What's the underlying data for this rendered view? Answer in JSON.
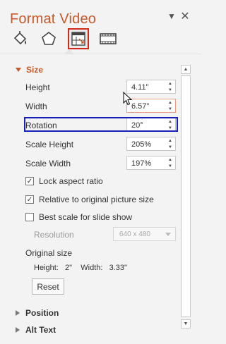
{
  "header": {
    "title": "Format Video",
    "dropdown_icon": "▼",
    "close_icon": "✕"
  },
  "tabs": [
    {
      "name": "fill-line-tab",
      "icon": "paint-bucket-icon"
    },
    {
      "name": "effects-tab",
      "icon": "pentagon-icon"
    },
    {
      "name": "size-properties-tab",
      "icon": "size-properties-icon",
      "selected": true
    },
    {
      "name": "video-tab",
      "icon": "film-strip-icon"
    }
  ],
  "size_section": {
    "title": "Size",
    "height_label": "Height",
    "height_value": "4.11\"",
    "width_label": "Width",
    "width_value": "6.57\"",
    "rotation_label": "Rotation",
    "rotation_value": "20°",
    "scale_height_label": "Scale Height",
    "scale_height_value": "205%",
    "scale_width_label": "Scale Width",
    "scale_width_value": "197%",
    "lock_aspect_label": "Lock aspect ratio",
    "lock_aspect_checked": true,
    "relative_label": "Relative to original picture size",
    "relative_checked": true,
    "best_scale_label": "Best scale for slide show",
    "best_scale_checked": false,
    "resolution_label": "Resolution",
    "resolution_value": "640 x 480",
    "original_size_label": "Original size",
    "original_size_values": "Height:   2\"    Width:   3.33\"",
    "reset_label": "Reset"
  },
  "collapsed_sections": [
    {
      "label": "Position"
    },
    {
      "label": "Alt Text"
    }
  ],
  "colors": {
    "accent": "#c55a2b",
    "highlight": "#1621b8",
    "tab_selected_outline": "#d12a1a"
  }
}
